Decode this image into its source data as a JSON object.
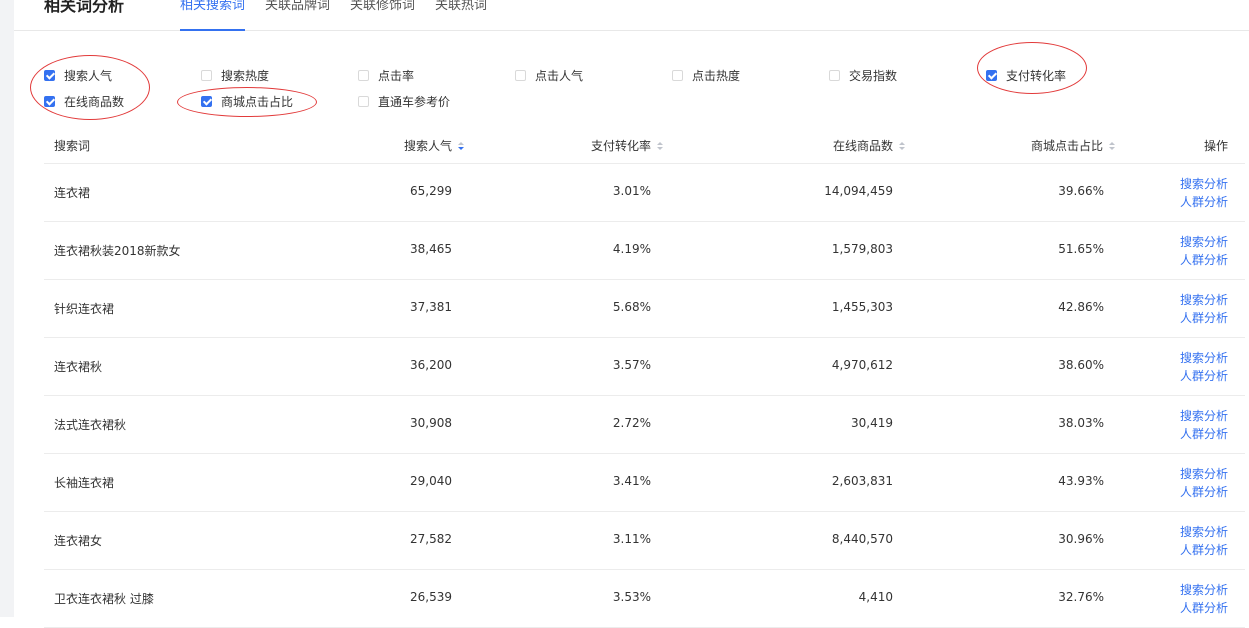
{
  "header": {
    "title": "相关词分析",
    "tabs": [
      {
        "label": "相关搜索词",
        "active": true
      },
      {
        "label": "关联品牌词",
        "active": false
      },
      {
        "label": "关联修饰词",
        "active": false
      },
      {
        "label": "关联热词",
        "active": false
      }
    ]
  },
  "filters": [
    {
      "label": "搜索人气",
      "checked": true
    },
    {
      "label": "搜索热度",
      "checked": false
    },
    {
      "label": "点击率",
      "checked": false
    },
    {
      "label": "点击人气",
      "checked": false
    },
    {
      "label": "点击热度",
      "checked": false
    },
    {
      "label": "交易指数",
      "checked": false
    },
    {
      "label": "支付转化率",
      "checked": true
    },
    {
      "label": "在线商品数",
      "checked": true
    },
    {
      "label": "商城点击占比",
      "checked": true
    },
    {
      "label": "直通车参考价",
      "checked": false
    }
  ],
  "table": {
    "headers": {
      "keyword": "搜索词",
      "popularity": "搜索人气",
      "conversion": "支付转化率",
      "online_items": "在线商品数",
      "mall_click": "商城点击占比",
      "actions": "操作"
    },
    "rows": [
      {
        "keyword": "连衣裙",
        "popularity": "65,299",
        "conversion": "3.01%",
        "online_items": "14,094,459",
        "mall_click": "39.66%"
      },
      {
        "keyword": "连衣裙秋装2018新款女",
        "popularity": "38,465",
        "conversion": "4.19%",
        "online_items": "1,579,803",
        "mall_click": "51.65%"
      },
      {
        "keyword": "针织连衣裙",
        "popularity": "37,381",
        "conversion": "5.68%",
        "online_items": "1,455,303",
        "mall_click": "42.86%"
      },
      {
        "keyword": "连衣裙秋",
        "popularity": "36,200",
        "conversion": "3.57%",
        "online_items": "4,970,612",
        "mall_click": "38.60%"
      },
      {
        "keyword": "法式连衣裙秋",
        "popularity": "30,908",
        "conversion": "2.72%",
        "online_items": "30,419",
        "mall_click": "38.03%"
      },
      {
        "keyword": "长袖连衣裙",
        "popularity": "29,040",
        "conversion": "3.41%",
        "online_items": "2,603,831",
        "mall_click": "43.93%"
      },
      {
        "keyword": "连衣裙女",
        "popularity": "27,582",
        "conversion": "3.11%",
        "online_items": "8,440,570",
        "mall_click": "30.96%"
      },
      {
        "keyword": "卫衣连衣裙秋 过膝",
        "popularity": "26,539",
        "conversion": "3.53%",
        "online_items": "4,410",
        "mall_click": "32.76%"
      }
    ],
    "action_search": "搜索分析",
    "action_crowd": "人群分析"
  },
  "colors": {
    "accent": "#3471f0",
    "annotation": "#e23b3b"
  }
}
